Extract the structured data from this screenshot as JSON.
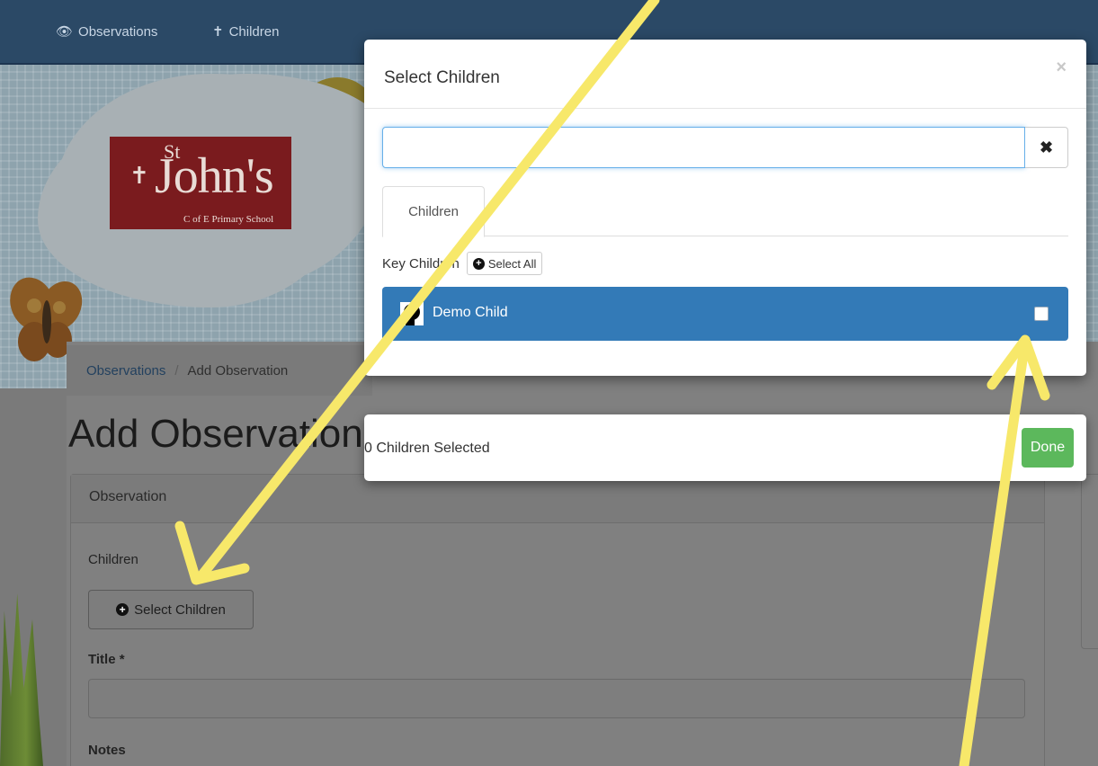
{
  "navbar": {
    "items": [
      {
        "label": "Observations",
        "icon": "eye-icon"
      },
      {
        "label": "Children",
        "icon": "child-icon"
      }
    ]
  },
  "logo": {
    "st": "St",
    "name": "John's",
    "subtitle": "C of E Primary School"
  },
  "breadcrumb": {
    "items": [
      "Observations",
      "Add Observation"
    ],
    "separator": "/"
  },
  "page": {
    "title": "Add Observation"
  },
  "panel": {
    "heading": "Observation",
    "children_label": "Children",
    "select_children_button": "Select Children",
    "title_label": "Title *",
    "notes_label": "Notes"
  },
  "modal": {
    "title": "Select Children",
    "close_symbol": "×",
    "search": {
      "value": "",
      "placeholder": ""
    },
    "clear_symbol": "✖",
    "tabs": [
      {
        "label": "Children",
        "active": true
      }
    ],
    "key_children_label": "Key Children",
    "select_all_button": "Select All",
    "children": [
      {
        "name": "Demo Child",
        "checked": false
      }
    ]
  },
  "footer": {
    "status": "0 Children Selected",
    "done_button": "Done"
  },
  "colors": {
    "navbar": "#2b4966",
    "primary": "#337ab7",
    "success": "#5cb85c",
    "annotation_arrow": "#f7e86a"
  }
}
